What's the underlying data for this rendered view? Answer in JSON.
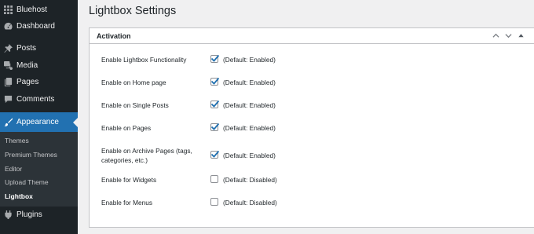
{
  "sidebar": {
    "items": [
      {
        "label": "Bluehost",
        "icon": "grid-icon"
      },
      {
        "label": "Dashboard",
        "icon": "dashboard-icon"
      },
      {
        "label": "Posts",
        "icon": "pin-icon"
      },
      {
        "label": "Media",
        "icon": "media-icon"
      },
      {
        "label": "Pages",
        "icon": "pages-icon"
      },
      {
        "label": "Comments",
        "icon": "comment-icon"
      },
      {
        "label": "Appearance",
        "icon": "brush-icon"
      },
      {
        "label": "Plugins",
        "icon": "plugin-icon"
      }
    ],
    "submenu": [
      "Themes",
      "Premium Themes",
      "Editor",
      "Upload Theme",
      "Lightbox"
    ],
    "active": "Appearance",
    "current_submenu": "Lightbox",
    "accent_color": "#2271b1"
  },
  "page": {
    "title": "Lightbox Settings"
  },
  "panel": {
    "title": "Activation",
    "controls": [
      "chevron-up-icon",
      "chevron-down-icon",
      "triangle-up-icon"
    ],
    "rows": [
      {
        "label": "Enable Lightbox Functionality",
        "checked": true,
        "note": "(Default: Enabled)"
      },
      {
        "label": "Enable on Home page",
        "checked": true,
        "note": "(Default: Enabled)"
      },
      {
        "label": "Enable on Single Posts",
        "checked": true,
        "note": "(Default: Enabled)"
      },
      {
        "label": "Enable on Pages",
        "checked": true,
        "note": "(Default: Enabled)"
      },
      {
        "label": "Enable on Archive Pages (tags, categories, etc.)",
        "checked": true,
        "note": "(Default: Enabled)"
      },
      {
        "label": "Enable for Widgets",
        "checked": false,
        "note": "(Default: Disabled)"
      },
      {
        "label": "Enable for Menus",
        "checked": false,
        "note": "(Default: Disabled)"
      }
    ]
  }
}
